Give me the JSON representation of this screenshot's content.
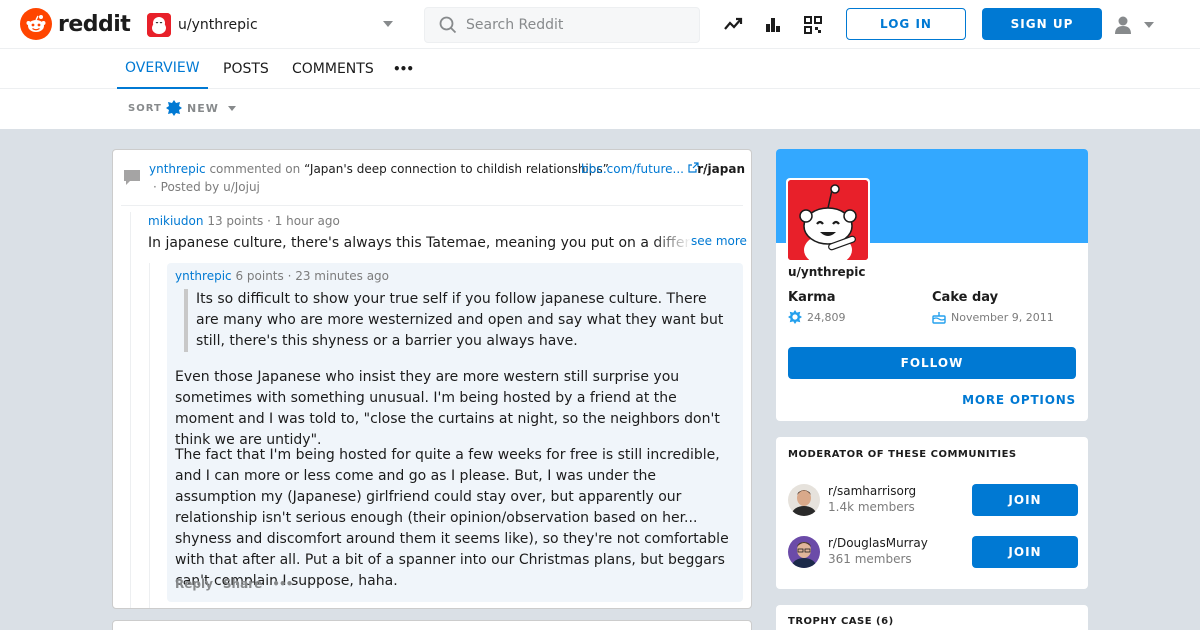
{
  "header": {
    "logo_text": "reddit",
    "user_dropdown_name": "u/ynthrepic",
    "search_placeholder": "Search Reddit",
    "login_label": "LOG IN",
    "signup_label": "SIGN UP",
    "icons": [
      "popular-icon",
      "stats-icon",
      "qr-code-icon",
      "user-icon"
    ]
  },
  "tabs": [
    {
      "label": "OVERVIEW",
      "active": true
    },
    {
      "label": "POSTS",
      "active": false
    },
    {
      "label": "COMMENTS",
      "active": false
    },
    {
      "label": "•••",
      "active": false
    }
  ],
  "sort": {
    "label": "SORT",
    "value": "NEW"
  },
  "post": {
    "commenter": "ynthrepic",
    "commented_on": "commented on",
    "title": "“Japan's deep connection to childish relationships”",
    "link": "bbc.com/future...",
    "subreddit": "r/japan",
    "posted_by": "· Posted by u/Jojuj"
  },
  "comment1": {
    "author": "mikiudon",
    "points": "13 points",
    "time": "1 hour ago",
    "body": "In japanese culture, there's always this Tatemae, meaning you put on a different face for the public",
    "see_more": "see more"
  },
  "reply": {
    "author": "ynthrepic",
    "points": "6 points",
    "time": "23 minutes ago",
    "quote": "Its so difficult to show your true self if you follow japanese culture. There are many who are more westernized and open and say what they want but still, there's this shyness or a barrier you always have.",
    "para1": "Even those Japanese who insist they are more western still surprise you sometimes with something unusual. I'm being hosted by a friend at the moment and I was told to, \"close the curtains at night, so the neighbors don't think we are untidy\".",
    "para2": "The fact that I'm being hosted for quite a few weeks for free is still incredible, and I can more or less come and go as I please. But, I was under the assumption my (Japanese) girlfriend could stay over, but apparently our relationship isn't serious enough (their opinion/observation based on her... shyness and discomfort around them it seems like), so they're not comfortable with that after all. Put a bit of a spanner into our Christmas plans, but beggars can't complain I suppose, haha.",
    "actions": {
      "reply": "Reply",
      "share": "Share",
      "more": "•••"
    }
  },
  "profile": {
    "username": "u/ynthrepic",
    "karma_label": "Karma",
    "karma_value": "24,809",
    "cakeday_label": "Cake day",
    "cakeday_value": "November 9, 2011",
    "follow_label": "FOLLOW",
    "more_options": "MORE OPTIONS",
    "banner_color": "#33a8ff"
  },
  "moderator": {
    "title": "MODERATOR OF THESE COMMUNITIES",
    "communities": [
      {
        "name": "r/samharrisorg",
        "members": "1.4k members",
        "join": "JOIN"
      },
      {
        "name": "r/DouglasMurray",
        "members": "361 members",
        "join": "JOIN"
      }
    ]
  },
  "trophy": {
    "title": "TROPHY CASE (6)"
  },
  "colors": {
    "accent": "#0079d3",
    "brand": "#ff4500",
    "background": "#dae0e6"
  }
}
